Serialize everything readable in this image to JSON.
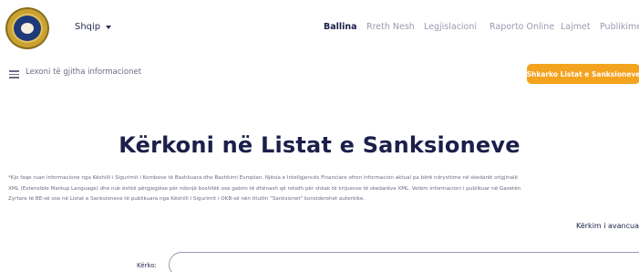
{
  "header": {
    "language": "Shqip",
    "nav": [
      {
        "label": "Ballina",
        "active": true
      },
      {
        "label": "Rreth Nesh",
        "active": false
      },
      {
        "label": "Legjislacioni",
        "active": false
      },
      {
        "label": "Raporto Online",
        "active": false
      },
      {
        "label": "Lajmet",
        "active": false
      },
      {
        "label": "Publikime",
        "active": false
      }
    ]
  },
  "toolbar": {
    "menu_link": "Lexoni të gjitha informacionet",
    "download_button": "Shkarko Listat e Sanksioneve"
  },
  "main": {
    "title": "Kërkoni në Listat e Sanksioneve",
    "note_lines": [
      "*Kjo faqe ruan informacione nga Këshilli i Sigurimit i Kombeve të Bashkuara dhe Bashkimi Evropian. Njësia e Inteligjencës Financiare ofron informacion aktual pa bërë ndryshime në skedarët origjinalë",
      "XML (Extensible Markup Language) dhe nuk është përgjegjëse për ndonjë boshllëk ose gabim të dhënash që ndodh për shkak të krijuesve të skedarëve XML. Vetëm informacioni i publikuar në Gazetën",
      "Zyrtare të BE-së ose në Listat e Sanksioneve të publikuara nga Këshilli i Sigurimit i OKB-së nën titullin \"Sanksionet\" konsiderohet autentike."
    ],
    "advanced_search": "Kërkim i avancuar",
    "search_label": "Kërko:",
    "search_value": ""
  },
  "colors": {
    "accent": "#f4a31e",
    "primary_text": "#1b1f4a",
    "muted_text": "#9a9bb0"
  }
}
